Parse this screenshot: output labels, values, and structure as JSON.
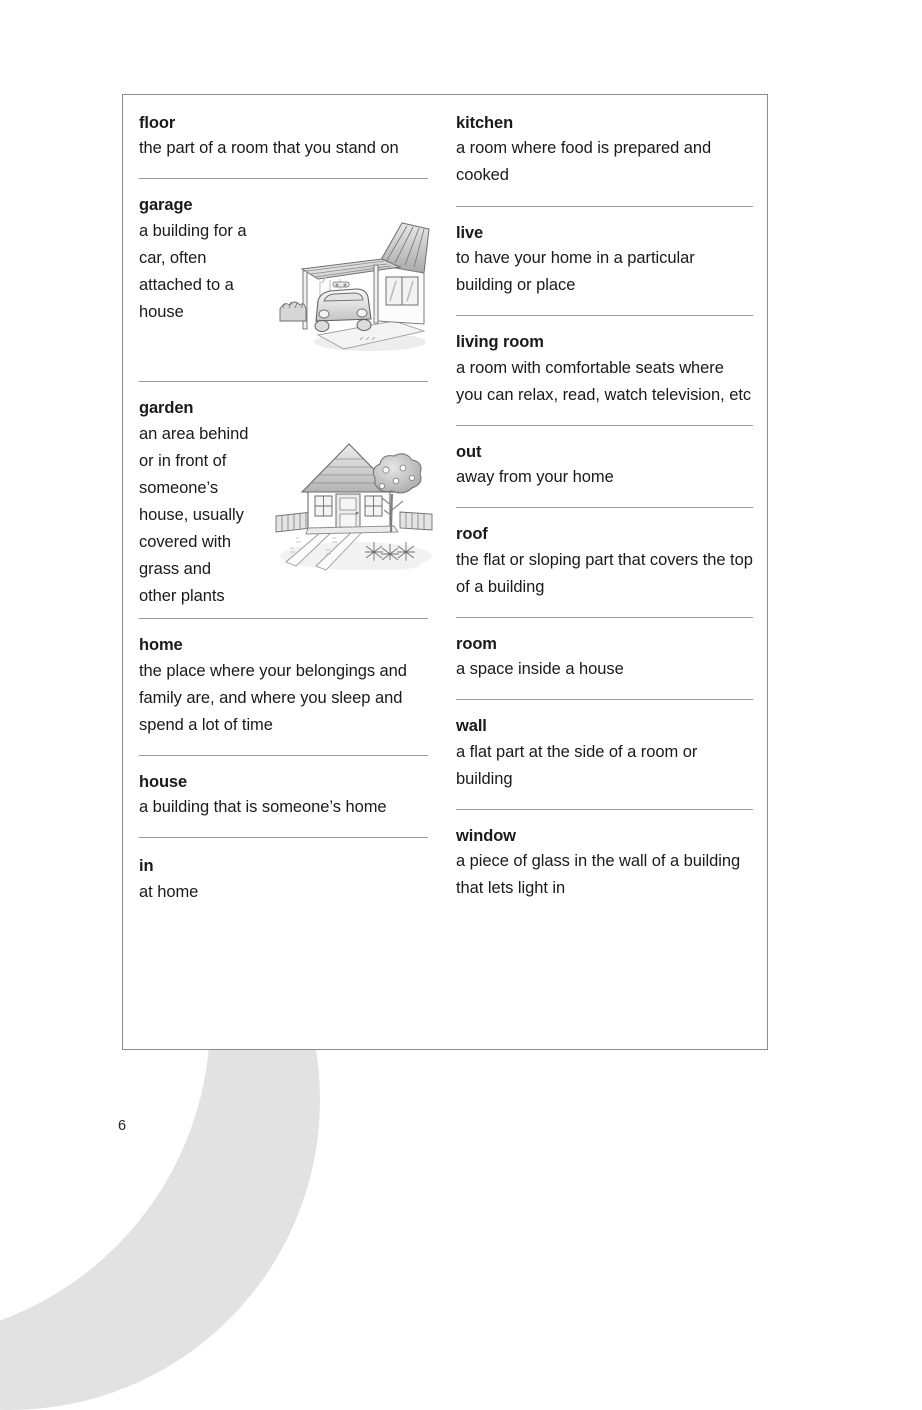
{
  "page": {
    "number": "6",
    "background_color": "#ffffff",
    "box_border_color": "#8a8a8f",
    "divider_color": "#9a9a9a",
    "decoration_color": "#e2e2e2"
  },
  "columns": {
    "left": {
      "entries": [
        {
          "headword": "floor",
          "definition": "the part of a room that you stand on",
          "illustration": null
        },
        {
          "headword": "garage",
          "definition": "a building for a car, often attached to a house",
          "illustration": "garage-carport-with-car-illustration"
        },
        {
          "headword": "garden",
          "definition": "an area behind or in front of someone’s house, usually covered with grass and other plants",
          "illustration": "house-with-garden-tree-and-fence-illustration"
        },
        {
          "headword": "home",
          "definition": "the place where your belongings and family are, and where you sleep and spend a lot of time",
          "illustration": null
        },
        {
          "headword": "house",
          "definition": "a building that is someone’s home",
          "illustration": null
        },
        {
          "headword": "in",
          "definition": "at home",
          "illustration": null
        }
      ]
    },
    "right": {
      "entries": [
        {
          "headword": "kitchen",
          "definition": "a room where food is prepared and cooked",
          "illustration": null
        },
        {
          "headword": "live",
          "definition": "to have your home in a particular building or place",
          "illustration": null
        },
        {
          "headword": "living room",
          "definition": "a room with comfortable seats where you can relax, read, watch television, etc",
          "illustration": null
        },
        {
          "headword": "out",
          "definition": "away from your home",
          "illustration": null
        },
        {
          "headword": "roof",
          "definition": "the flat or sloping part that covers the top of a building",
          "illustration": null
        },
        {
          "headword": "room",
          "definition": "a space inside a house",
          "illustration": null
        },
        {
          "headword": "wall",
          "definition": "a flat part at the side of a room or building",
          "illustration": null
        },
        {
          "headword": "window",
          "definition": "a piece of glass in the wall of a building that lets light in",
          "illustration": null
        }
      ]
    }
  }
}
